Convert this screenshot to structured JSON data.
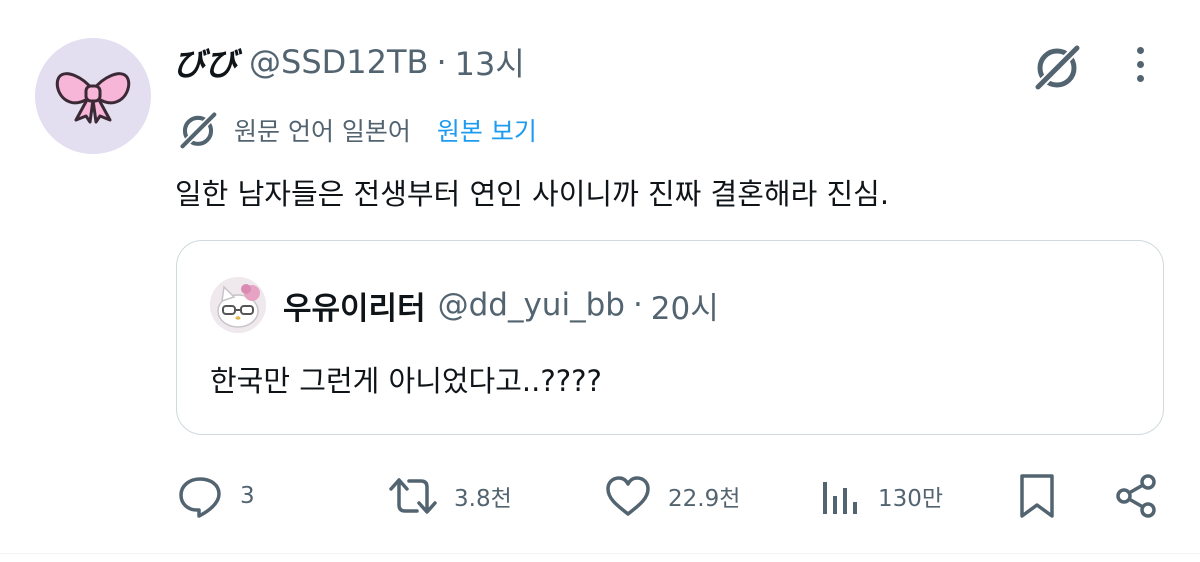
{
  "tweet": {
    "display_name": "びび",
    "handle": "@SSD12TB",
    "separator": "·",
    "time": "13시",
    "translation": {
      "lang_label": "원문 언어 일본어",
      "view_original": "원본 보기"
    },
    "text": "일한 남자들은 전생부터 연인 사이니까 진짜 결혼해라 진심."
  },
  "quote": {
    "display_name": "우유이리터",
    "handle": "@dd_yui_bb",
    "separator": "·",
    "time": "20시",
    "text": "한국만 그런게 아니었다고..????"
  },
  "actions": {
    "replies": "3",
    "reposts": "3.8천",
    "likes": "22.9천",
    "views": "130만"
  },
  "icons": {
    "grok": "grok-icon",
    "more": "more-icon",
    "reply": "reply-icon",
    "repost": "repost-icon",
    "like": "heart-icon",
    "views": "views-icon",
    "bookmark": "bookmark-icon",
    "share": "share-icon"
  },
  "colors": {
    "text": "#0f1419",
    "secondary": "#536471",
    "link": "#1d9bf0",
    "border": "#cfd9de",
    "avatar_bg": "#e3def0",
    "bow_fill": "#f7b6d8",
    "bow_stroke": "#3b2a36"
  }
}
